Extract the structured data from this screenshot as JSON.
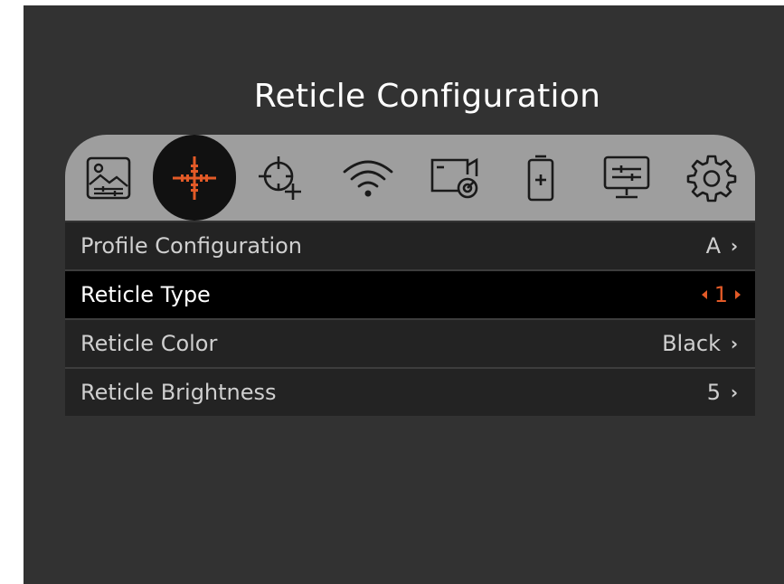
{
  "screen": {
    "title": "Reticle Configuration"
  },
  "tabs": [
    {
      "icon": "image-adjust-icon",
      "active": false
    },
    {
      "icon": "reticle-crosshair-icon",
      "active": true
    },
    {
      "icon": "zeroing-target-icon",
      "active": false
    },
    {
      "icon": "wifi-icon",
      "active": false
    },
    {
      "icon": "video-record-icon",
      "active": false
    },
    {
      "icon": "battery-icon",
      "active": false
    },
    {
      "icon": "display-settings-icon",
      "active": false
    },
    {
      "icon": "gear-icon",
      "active": false
    }
  ],
  "menu": {
    "items": [
      {
        "label": "Profile Configuration",
        "value": "A"
      },
      {
        "label": "Reticle Type",
        "value": "1",
        "selected": true
      },
      {
        "label": "Reticle Color",
        "value": "Black"
      },
      {
        "label": "Reticle Brightness",
        "value": "5"
      }
    ]
  },
  "colors": {
    "accent": "#e35a27",
    "background": "#323232",
    "tabbar": "#9e9e9e",
    "row": "#232323",
    "row_selected": "#000000"
  }
}
